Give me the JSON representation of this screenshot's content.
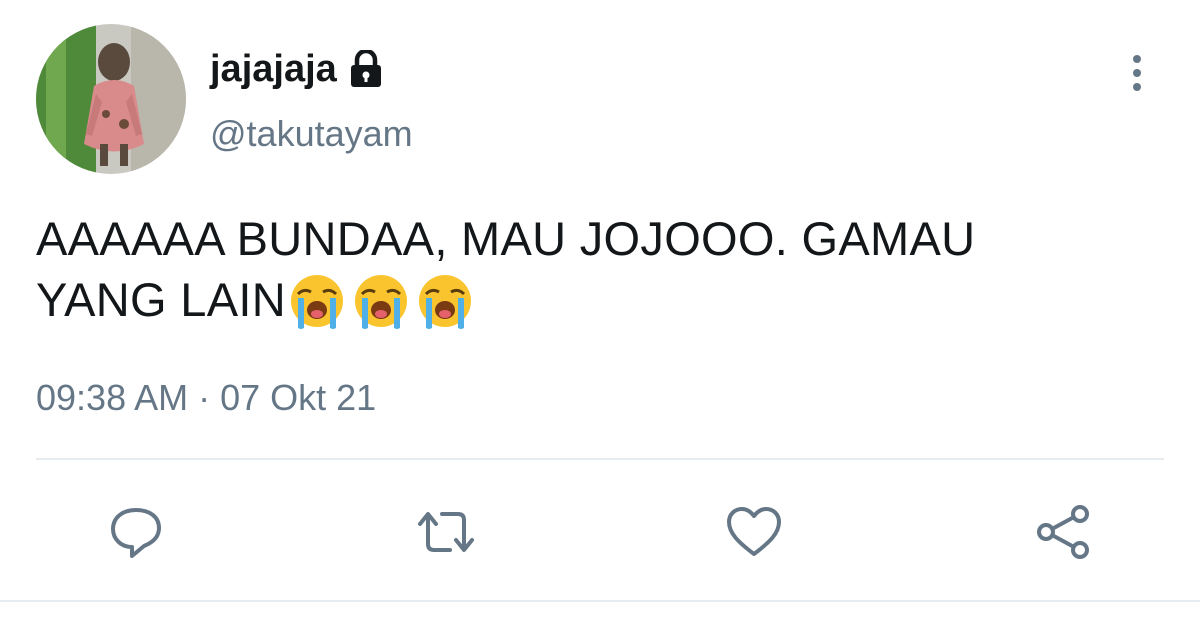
{
  "tweet": {
    "display_name": "jajajaja",
    "handle": "@takutayam",
    "text_line1": "AAAAAA BUNDAA, MAU JOJOOO. GAMAU",
    "text_line2": "YANG LAIN",
    "emojis": [
      "loudly-crying-face",
      "loudly-crying-face",
      "loudly-crying-face"
    ],
    "timestamp": "09:38 AM · 07 Okt 21",
    "protected": true
  },
  "icons": {
    "lock": "lock-icon",
    "more": "more-vertical-icon",
    "reply": "reply-icon",
    "retweet": "retweet-icon",
    "like": "heart-icon",
    "share": "share-icon"
  },
  "colors": {
    "text": "#14171a",
    "secondary": "#657786",
    "icon": "#657786",
    "divider": "#e6ecf0"
  }
}
